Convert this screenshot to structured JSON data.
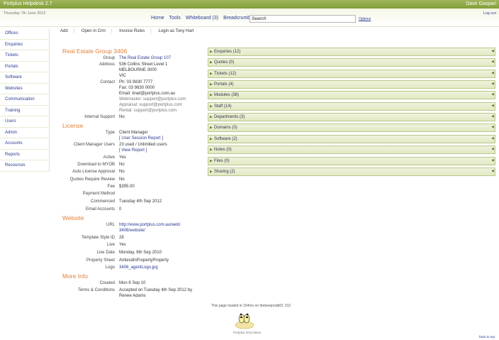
{
  "topbar": {
    "app_title": "Portplus Helpdesk 2.7",
    "user": "Dave Gaspari"
  },
  "header": {
    "date": "Thursday 7th June 2012",
    "logout": "Log out",
    "nav": [
      "Home",
      "Tools",
      "Whiteboard (3)",
      "Breadcrumbs"
    ],
    "search_value": "Search",
    "options": "Options"
  },
  "sidebar": {
    "items": [
      {
        "label": "Offices"
      },
      {
        "label": "Enquiries"
      },
      {
        "label": "Tickets"
      },
      {
        "label": "Portals"
      },
      {
        "label": "Software"
      },
      {
        "label": "Websites"
      },
      {
        "label": "Communication"
      },
      {
        "label": "Training"
      },
      {
        "label": "Users"
      },
      {
        "label": "Admin"
      },
      {
        "label": "Accounts"
      },
      {
        "label": "Reports"
      },
      {
        "label": "Resources"
      }
    ]
  },
  "actions": [
    "Add",
    "Open in Crm",
    "Invoice Rules",
    "Login as Tony Hart"
  ],
  "office": {
    "title": "Real Estate Group 3406",
    "group_label": "Group",
    "group_value": "The Real Estate Group 107",
    "address_label": "Address",
    "address": [
      "536 Collins Street Level 1",
      "MELBOURNE 3000",
      "VIC"
    ],
    "contact_label": "Contact",
    "contact": [
      "Ph: 03 9830 7777",
      "Fax: 03 9830 0000",
      "Email: brad@portplus.com.au"
    ],
    "contact_grey": [
      "Webmaster: support@portplus.com",
      "Appraisal: support@portplus.com",
      "Rental: support@portplus.com"
    ],
    "internal_label": "Internal Support",
    "internal_value": "No"
  },
  "license": {
    "title": "License",
    "rows": [
      {
        "label": "Type",
        "value": "Client Manager",
        "sub": "[ User Session Report ]"
      },
      {
        "label": "Client Manager Users",
        "value": "23 used / Unlimited users",
        "sub": "[ View Report ]"
      },
      {
        "label": "Active",
        "value": "Yes"
      },
      {
        "label": "Download to MYOB",
        "value": "No"
      },
      {
        "label": "Auto License Approval",
        "value": "No"
      },
      {
        "label": "Quotes Require Review",
        "value": "No"
      },
      {
        "label": "Fee",
        "value": "$395.00"
      },
      {
        "label": "Payment Method",
        "value": ""
      },
      {
        "label": "Commenced",
        "value": "Tuesday 4th Sep 2012"
      },
      {
        "label": "Email Accounts",
        "value": "0"
      }
    ]
  },
  "website": {
    "title": "Website",
    "rows": [
      {
        "label": "URL",
        "value": "http://www.portplus.com.au/web/",
        "sub": "3406/website/"
      },
      {
        "label": "Template Style ID",
        "value": "28"
      },
      {
        "label": "Live",
        "value": "Yes"
      },
      {
        "label": "Live Date",
        "value": "Monday, 6th Sep 2010"
      },
      {
        "label": "Property Sheet",
        "value": "AntiesdinPropertyProperty"
      },
      {
        "label": "Logo",
        "value": "3406_agentLogo.jpg"
      }
    ]
  },
  "more_info": {
    "title": "More Info",
    "rows": [
      {
        "label": "Created",
        "value": "Mon 6 Sep 10"
      },
      {
        "label": "Terms & Conditions",
        "value": "Accepted on Tuesday 4th Sep 2012 by",
        "sub": "Renee Adams"
      }
    ]
  },
  "panels": [
    "Enquiries (12)",
    "Quotes (0)",
    "Tickets (12)",
    "Portals (4)",
    "Modules (38)",
    "Staff (14)",
    "Departments (3)",
    "Domains (0)",
    "Software (2)",
    "Notes (0)",
    "Files (0)",
    "Sharing (2)"
  ],
  "footer": {
    "loaded_text": "This page loaded in 154ms on thebeeprodd01 153",
    "copyright": "Portplus 2012 Bees",
    "back_to_top": "back to top"
  }
}
